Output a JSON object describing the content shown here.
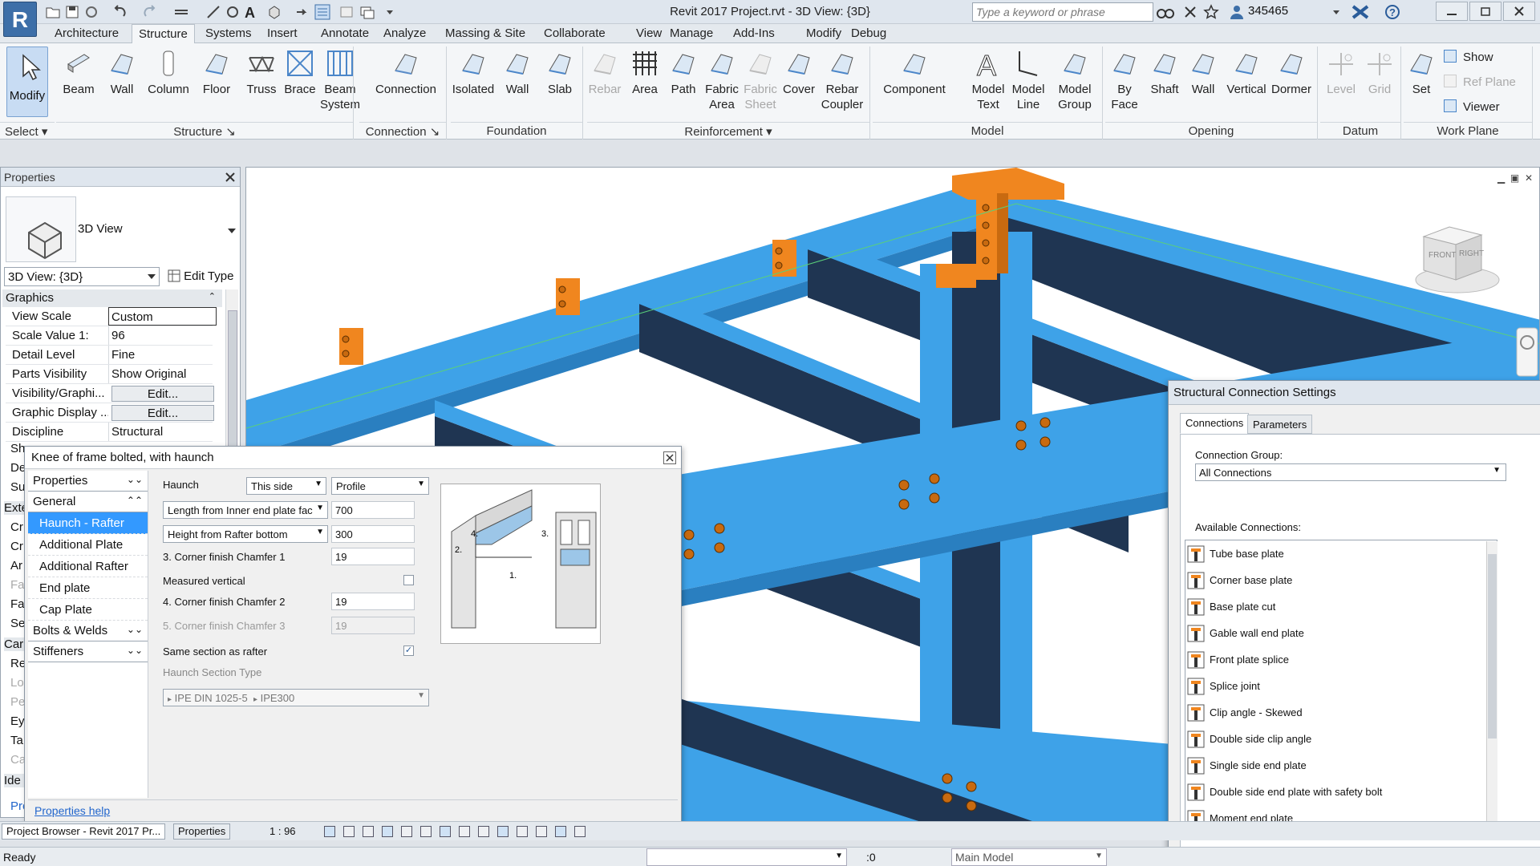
{
  "app": {
    "title": "Revit 2017 Project.rvt - 3D View: {3D}",
    "logo_letter": "R",
    "search_placeholder": "Type a keyword or phrase",
    "user_id": "345465"
  },
  "tabs": [
    "Architecture",
    "Structure",
    "Systems",
    "Insert",
    "Annotate",
    "Analyze",
    "Massing & Site",
    "Collaborate",
    "View",
    "Manage",
    "Add-Ins",
    "Modify",
    "Debug"
  ],
  "active_tab": "Structure",
  "ribbon": {
    "modify": "Modify",
    "select_group": "Select",
    "buttons": [
      {
        "l1": "Beam",
        "l2": ""
      },
      {
        "l1": "Wall",
        "l2": ""
      },
      {
        "l1": "Column",
        "l2": ""
      },
      {
        "l1": "Floor",
        "l2": ""
      },
      {
        "l1": "Truss",
        "l2": ""
      },
      {
        "l1": "Brace",
        "l2": ""
      },
      {
        "l1": "Beam",
        "l2": "System"
      },
      {
        "l1": "Connection",
        "l2": ""
      },
      {
        "l1": "Isolated",
        "l2": ""
      },
      {
        "l1": "Wall",
        "l2": ""
      },
      {
        "l1": "Slab",
        "l2": ""
      },
      {
        "l1": "Rebar",
        "l2": ""
      },
      {
        "l1": "Area",
        "l2": ""
      },
      {
        "l1": "Path",
        "l2": ""
      },
      {
        "l1": "Fabric",
        "l2": "Area"
      },
      {
        "l1": "Fabric",
        "l2": "Sheet"
      },
      {
        "l1": "Cover",
        "l2": ""
      },
      {
        "l1": "Rebar",
        "l2": "Coupler"
      },
      {
        "l1": "Component",
        "l2": ""
      },
      {
        "l1": "Model",
        "l2": "Text"
      },
      {
        "l1": "Model",
        "l2": "Line"
      },
      {
        "l1": "Model",
        "l2": "Group"
      },
      {
        "l1": "By",
        "l2": "Face"
      },
      {
        "l1": "Shaft",
        "l2": ""
      },
      {
        "l1": "Wall",
        "l2": ""
      },
      {
        "l1": "Vertical",
        "l2": ""
      },
      {
        "l1": "Dormer",
        "l2": ""
      },
      {
        "l1": "Level",
        "l2": ""
      },
      {
        "l1": "Grid",
        "l2": ""
      },
      {
        "l1": "Set",
        "l2": ""
      }
    ],
    "workplane_small": [
      "Show",
      "Ref  Plane",
      "Viewer"
    ],
    "groups": [
      "Structure",
      "Connection",
      "Foundation",
      "Reinforcement",
      "Model",
      "Opening",
      "Datum",
      "Work Plane"
    ]
  },
  "properties": {
    "title": "Properties",
    "type_name": "3D View",
    "view_selector": "3D View: {3D}",
    "edit_type": "Edit Type",
    "section_graphics": "Graphics",
    "rows": [
      {
        "k": "View Scale",
        "v": "Custom"
      },
      {
        "k": "Scale Value    1:",
        "v": "96"
      },
      {
        "k": "Detail Level",
        "v": "Fine"
      },
      {
        "k": "Parts Visibility",
        "v": "Show Original"
      },
      {
        "k": "Visibility/Graphi...",
        "v": "Edit..."
      },
      {
        "k": "Graphic Display ...",
        "v": "Edit..."
      },
      {
        "k": "Discipline",
        "v": "Structural"
      }
    ],
    "truncated_rows": [
      "Sh",
      "De",
      "Su",
      "Exte",
      "Cr",
      "Cr",
      "Ar",
      "Fa",
      "Fa",
      "Se",
      "Car",
      "Re",
      "Lo",
      "Pe",
      "Ey",
      "Ta",
      "Ca",
      "Ide",
      "Pro"
    ]
  },
  "knee_dialog": {
    "title": "Knee of frame bolted, with haunch",
    "nav_properties": "Properties",
    "nav_general": "General",
    "nav_items": [
      "Haunch - Rafter",
      "Additional Plate",
      "Additional Rafter",
      "End plate",
      "Cap Plate"
    ],
    "nav_bolts": "Bolts & Welds",
    "nav_stiffeners": "Stiffeners",
    "haunch_label": "Haunch",
    "haunch_side": "This side",
    "haunch_profile": "Profile",
    "length_sel": "Length from Inner end plate fac",
    "length_val": "700",
    "height_sel": "Height from Rafter bottom",
    "height_val": "300",
    "chamfer1_label": "3. Corner finish Chamfer 1",
    "chamfer1_val": "19",
    "measured_vertical": "Measured vertical",
    "chamfer2_label": "4. Corner finish Chamfer 2",
    "chamfer2_val": "19",
    "chamfer3_label": "5. Corner finish Chamfer 3",
    "chamfer3_val": "19",
    "same_section": "Same section as rafter",
    "section_type": "Haunch Section Type",
    "section_path1": "IPE DIN 1025-5",
    "section_path2": "IPE300",
    "diagram_labels": [
      "4.",
      "2.",
      "3.",
      "1."
    ],
    "help": "Properties help"
  },
  "scs_dialog": {
    "title": "Structural Connection Settings",
    "tab_connections": "Connections",
    "tab_parameters": "Parameters",
    "group_label": "Connection Group:",
    "group_value": "All Connections",
    "available_label": "Available Connections:",
    "items": [
      "Tube base plate",
      "Corner base plate",
      "Base plate cut",
      "Gable wall end plate",
      "Front plate splice",
      "Splice joint",
      "Clip angle - Skewed",
      "Double side clip angle",
      "Single side end plate",
      "Double side end plate with safety bolt",
      "Moment end plate"
    ]
  },
  "viewcube": {
    "front": "FRONT",
    "right": "RIGHT"
  },
  "bottom": {
    "project_browser": "Project Browser - Revit 2017 Pr...",
    "properties_tab": "Properties",
    "scale": "1 : 96"
  },
  "status": {
    "ready": "Ready",
    "zero": ":0",
    "model": "Main Model"
  },
  "colors": {
    "steel": "#3ea2e8",
    "steel_dark": "#1f3552",
    "plate": "#f0861f",
    "selection": "#3399ff"
  }
}
